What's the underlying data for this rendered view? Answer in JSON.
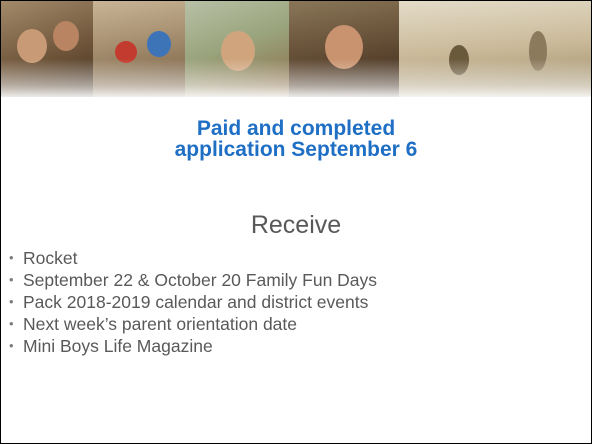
{
  "slide": {
    "title_line1": "Paid and completed",
    "title_line2": "application September 6",
    "subtitle": "Receive",
    "bullet_glyph": "•",
    "bullets": [
      "Rocket",
      "September 22 & October 20 Family Fun Days",
      "Pack 2018-2019 calendar and district events",
      "Next week’s parent orientation date",
      "Mini Boys Life Magazine"
    ]
  },
  "colors": {
    "title": "#1f6fc5",
    "body_text": "#595959"
  }
}
